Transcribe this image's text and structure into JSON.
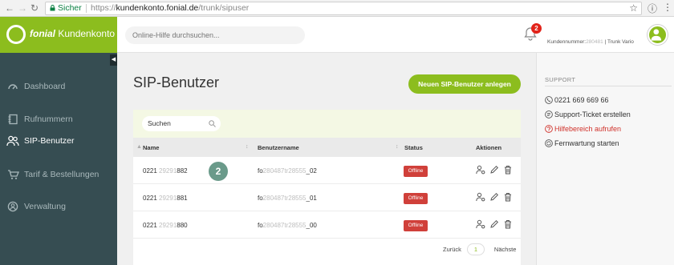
{
  "browser": {
    "secure_label": "Sicher",
    "url_prefix": "https://",
    "url_host": "kundenkonto.fonial.de",
    "url_path": "/trunk/sipuser"
  },
  "header": {
    "brand_bold": "fonial",
    "brand_rest": "Kundenkonto",
    "search_placeholder": "Online-Hilfe durchsuchen...",
    "notification_count": "2",
    "customer_label": "Kundennummer:",
    "customer_number": "280481",
    "customer_suffix": " | Trunk Vario"
  },
  "sidebar": {
    "items": [
      {
        "label": "Dashboard",
        "icon": "dashboard-icon"
      },
      {
        "label": "Rufnummern",
        "icon": "phone-book-icon"
      },
      {
        "label": "SIP-Benutzer",
        "icon": "users-icon"
      },
      {
        "label": "Tarif & Bestellungen",
        "icon": "cart-icon"
      },
      {
        "label": "Verwaltung",
        "icon": "settings-icon"
      }
    ]
  },
  "main": {
    "title": "SIP-Benutzer",
    "new_button": "Neuen SIP-Benutzer anlegen",
    "search_placeholder": "Suchen",
    "columns": {
      "name": "Name",
      "username": "Benutzername",
      "status": "Status",
      "actions": "Aktionen"
    },
    "rows": [
      {
        "name_a": "0221 ",
        "name_b": "29291",
        "name_c": "882",
        "user_a": "fo",
        "user_b": "280487tr28555",
        "user_c": "_02",
        "status": "Offline"
      },
      {
        "name_a": "0221 ",
        "name_b": "29291",
        "name_c": "881",
        "user_a": "fo",
        "user_b": "280487tr28555",
        "user_c": "_01",
        "status": "Offline"
      },
      {
        "name_a": "0221 ",
        "name_b": "29291",
        "name_c": "880",
        "user_a": "fo",
        "user_b": "280487tr28555",
        "user_c": "_00",
        "status": "Offline"
      }
    ],
    "step_marker": "2",
    "pager": {
      "prev": "Zurück",
      "page": "1",
      "next": "Nächste"
    }
  },
  "support": {
    "heading": "SUPPORT",
    "phone": "0221 669 669 66",
    "ticket": "Support-Ticket erstellen",
    "help": "Hilfebereich aufrufen",
    "remote": "Fernwartung starten"
  },
  "colors": {
    "brand": "#8cbd1e",
    "sidebar": "#364d52",
    "offline": "#d0403a",
    "help_link": "#d0312a"
  }
}
